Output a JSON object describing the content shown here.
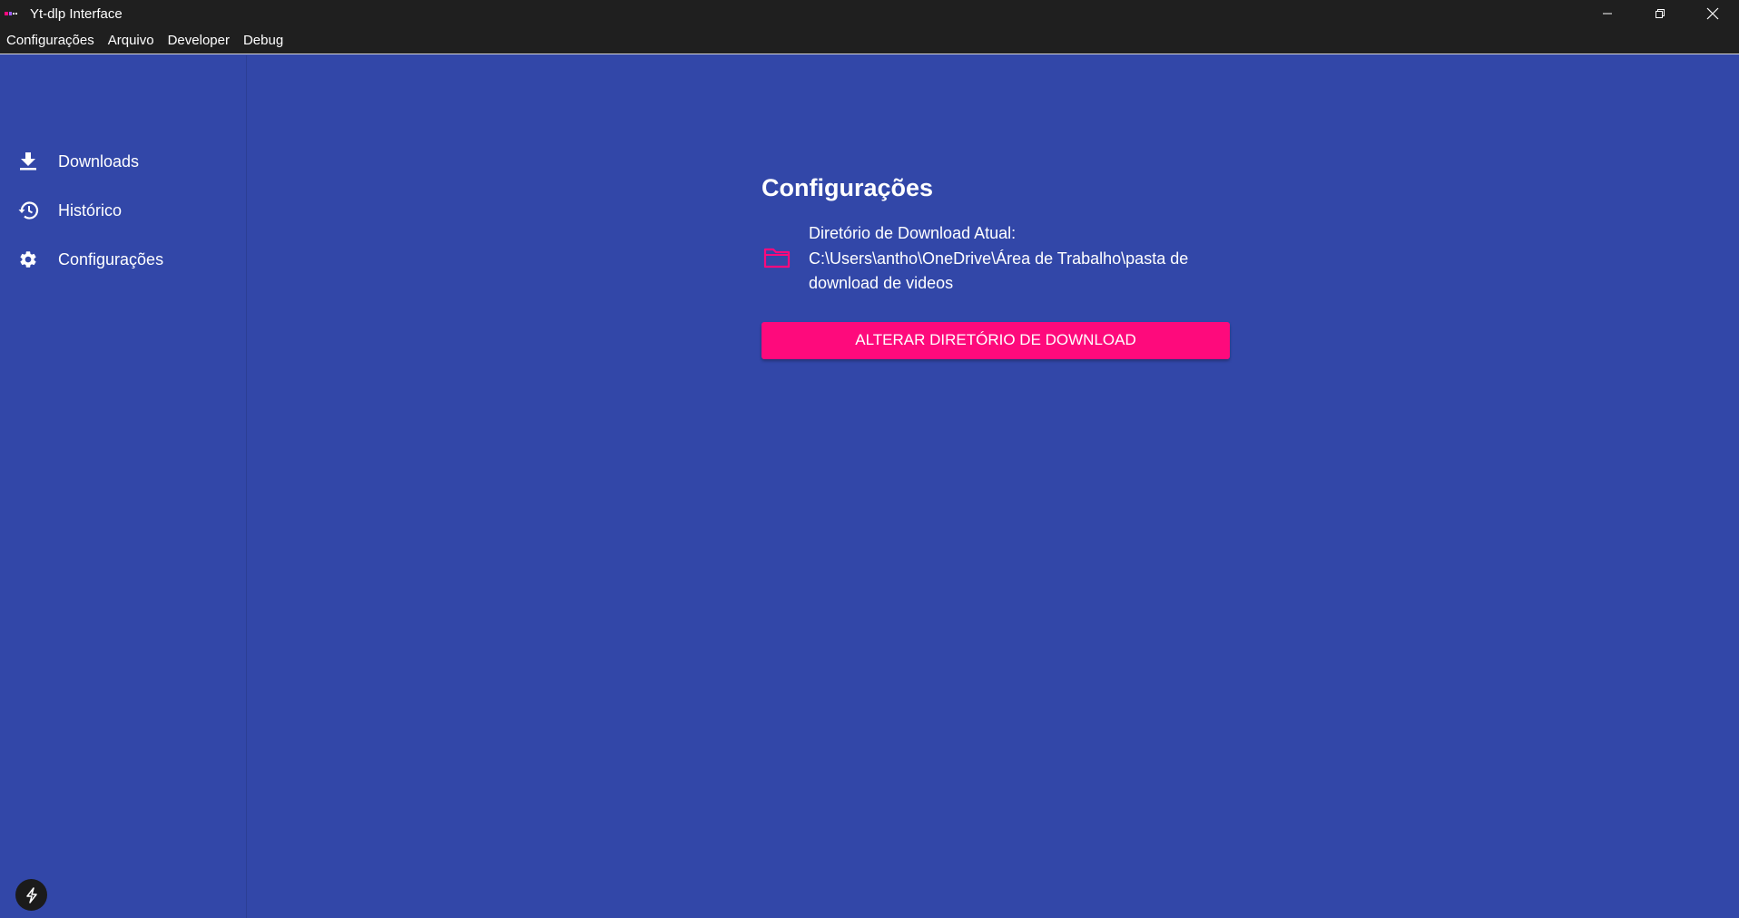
{
  "window": {
    "title": "Yt-dlp Interface",
    "controls": [
      "minimize-icon",
      "restore-icon",
      "close-icon"
    ]
  },
  "menubar": {
    "items": [
      "Configurações",
      "Arquivo",
      "Developer",
      "Debug"
    ]
  },
  "sidebar": {
    "items": [
      {
        "label": "Downloads",
        "icon": "download-icon"
      },
      {
        "label": "Histórico",
        "icon": "history-icon"
      },
      {
        "label": "Configurações",
        "icon": "gear-icon"
      }
    ],
    "footer_icon": "bolt-icon"
  },
  "main": {
    "title": "Configurações",
    "dir_label": "Diretório de Download Atual:",
    "dir_path": "C:\\Users\\antho\\OneDrive\\Área de Trabalho\\pasta de download de videos",
    "button_label": "ALTERAR DIRETÓRIO DE DOWNLOAD"
  },
  "colors": {
    "background": "#3247a8",
    "titlebar": "#1f1f1f",
    "accent": "#fe0a7c"
  }
}
